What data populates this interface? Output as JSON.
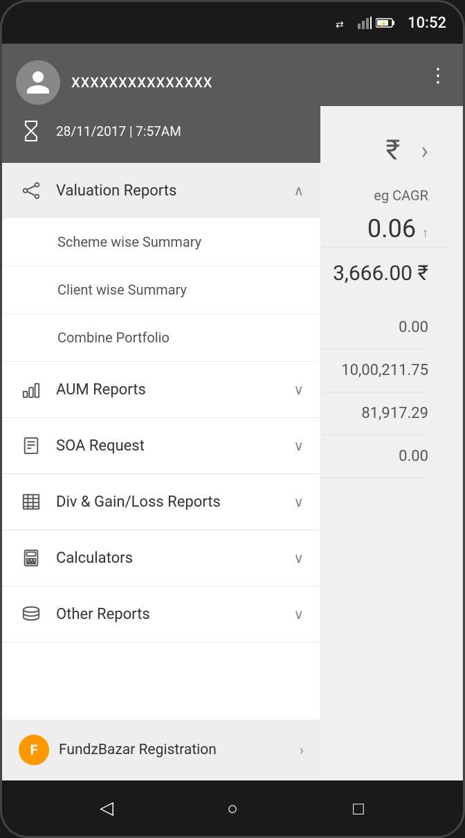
{
  "status_bar": {
    "time": "10:52"
  },
  "drawer": {
    "user": {
      "name": "XXXXXXXXXXXXXXX"
    },
    "date": "28/11/2017 | 7:57AM",
    "valuation_reports": {
      "label": "Valuation Reports",
      "sub_items": [
        {
          "label": "Scheme wise Summary"
        },
        {
          "label": "Client wise Summary"
        },
        {
          "label": "Combine Portfolio"
        }
      ]
    },
    "menu_items": [
      {
        "id": "aum",
        "label": "AUM Reports"
      },
      {
        "id": "soa",
        "label": "SOA Request"
      },
      {
        "id": "div",
        "label": "Div & Gain/Loss Reports"
      },
      {
        "id": "calc",
        "label": "Calculators"
      },
      {
        "id": "other",
        "label": "Other Reports"
      }
    ],
    "fundzbazar": {
      "label": "FundzBazar Registration"
    }
  },
  "background": {
    "cagr_label": "eg CAGR",
    "cagr_value": "0.06",
    "total_value": "3,666.00 ₹",
    "rows": [
      {
        "value": "0.00"
      },
      {
        "value": "10,00,211.75"
      },
      {
        "value": "81,917.29"
      },
      {
        "value": "0.00"
      }
    ]
  },
  "nav": {
    "back_label": "◁",
    "home_label": "○",
    "square_label": "□"
  }
}
